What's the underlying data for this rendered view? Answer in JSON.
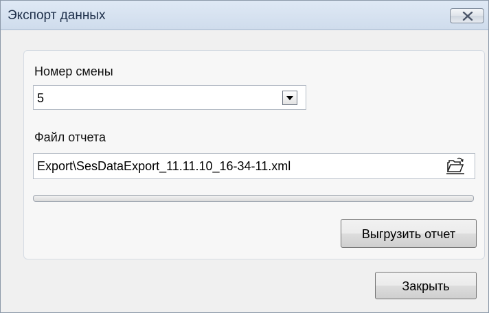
{
  "window": {
    "title": "Экспорт данных",
    "close_icon": "close-x-icon"
  },
  "shift": {
    "label": "Номер смены",
    "selected": "5",
    "dropdown_icon": "chevron-down-icon"
  },
  "report": {
    "label": "Файл отчета",
    "path": "Export\\SesDataExport_11.11.10_16-34-11.xml",
    "browse_icon": "open-folder-icon"
  },
  "progress": {
    "value_percent": 0
  },
  "buttons": {
    "export_label": "Выгрузить отчет",
    "close_label": "Закрыть"
  }
}
